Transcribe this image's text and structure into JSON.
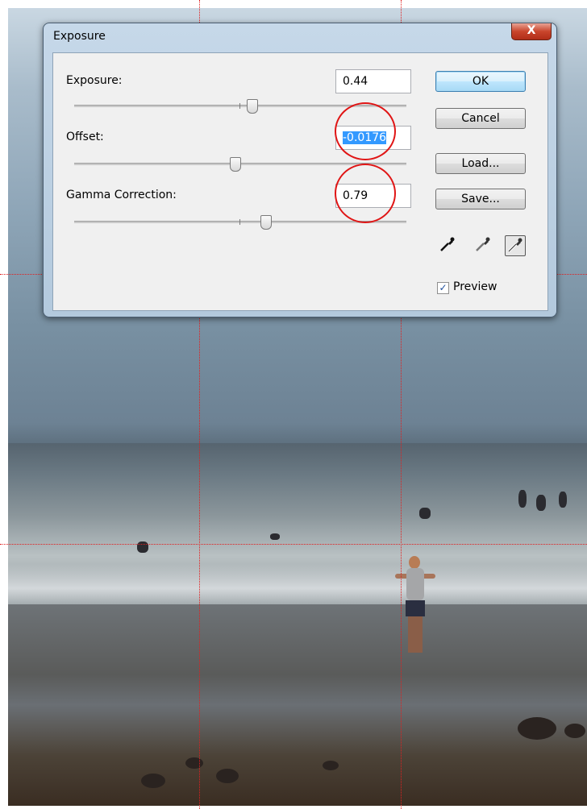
{
  "dialog": {
    "title": "Exposure",
    "close_label": "X",
    "exposure": {
      "label": "Exposure:",
      "value": "0.44"
    },
    "offset": {
      "label": "Offset:",
      "value": "-0.0176"
    },
    "gamma": {
      "label": "Gamma Correction:",
      "value": "0.79"
    },
    "buttons": {
      "ok": "OK",
      "cancel": "Cancel",
      "load": "Load...",
      "save": "Save..."
    },
    "eyedroppers": [
      "black-point-eyedropper-icon",
      "gray-point-eyedropper-icon",
      "white-point-eyedropper-icon"
    ],
    "preview": {
      "label": "Preview",
      "checked": true,
      "check_glyph": "✓"
    }
  },
  "colors": {
    "guide_lines": "#e02020",
    "highlight_circle": "#e01515",
    "selection": "#3399ff"
  }
}
